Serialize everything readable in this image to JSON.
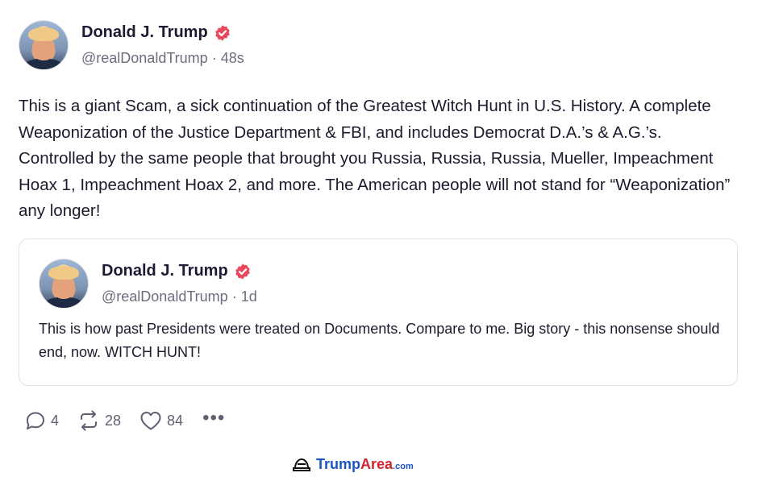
{
  "post": {
    "author_name": "Donald J. Trump",
    "handle": "@realDonaldTrump",
    "separator": "·",
    "time": "48s",
    "text": "This is a giant Scam, a sick continuation of the Greatest Witch Hunt in U.S. History. A complete Weaponization of the Justice Department & FBI, and includes Democrat D.A.’s & A.G.’s. Controlled by the same people that brought you Russia, Russia, Russia, Mueller, Impeachment Hoax 1, Impeachment Hoax 2, and more. The American people will not stand for “Weaponization” any longer!",
    "verified_icon": "verified-badge-icon",
    "verified_color": "#e8475c"
  },
  "quoted_post": {
    "author_name": "Donald J. Trump",
    "handle": "@realDonaldTrump",
    "separator": "·",
    "time": "1d",
    "text": "This is how past Presidents were treated on Documents. Compare to me. Big story - this nonsense should end, now. WITCH HUNT!"
  },
  "actions": {
    "replies": "4",
    "reposts": "28",
    "likes": "84",
    "more": "•••"
  },
  "watermark": {
    "word1": "Trump",
    "word2": "Area",
    "suffix": ".com",
    "icon": "hat-logo-icon"
  },
  "colors": {
    "text": "#1c1b2e",
    "muted": "#6c6c7e",
    "verified": "#e8475c",
    "border": "#e2e2e8",
    "watermark_blue": "#1a56c4",
    "watermark_red": "#d0262f"
  }
}
